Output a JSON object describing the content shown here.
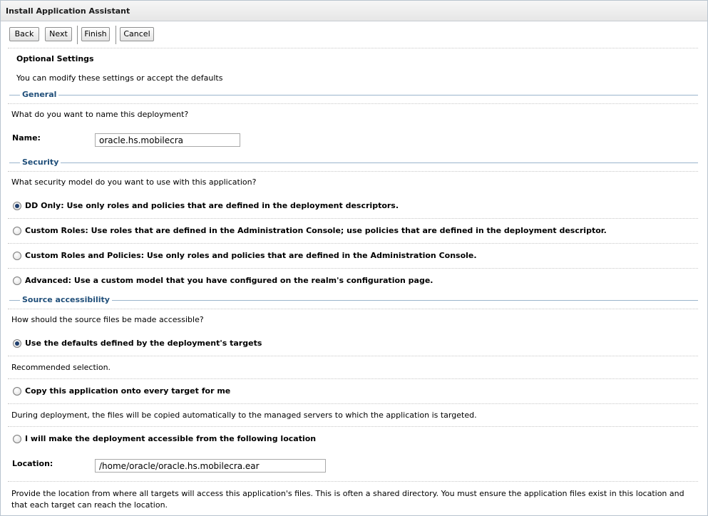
{
  "window": {
    "title": "Install Application Assistant"
  },
  "toolbar": {
    "back": "Back",
    "next": "Next",
    "finish": "Finish",
    "cancel": "Cancel"
  },
  "optional": {
    "heading": "Optional Settings",
    "subtitle": "You can modify these settings or accept the defaults"
  },
  "general": {
    "title": "General",
    "question": "What do you want to name this deployment?",
    "name_label": "Name:",
    "name_value": "oracle.hs.mobilecra"
  },
  "security": {
    "title": "Security",
    "question": "What security model do you want to use with this application?",
    "options": [
      {
        "label": "DD Only: Use only roles and policies that are defined in the deployment descriptors.",
        "selected": true
      },
      {
        "label": "Custom Roles: Use roles that are defined in the Administration Console; use policies that are defined in the deployment descriptor.",
        "selected": false
      },
      {
        "label": "Custom Roles and Policies: Use only roles and policies that are defined in the Administration Console.",
        "selected": false
      },
      {
        "label": "Advanced: Use a custom model that you have configured on the realm's configuration page.",
        "selected": false
      }
    ]
  },
  "source": {
    "title": "Source accessibility",
    "question": "How should the source files be made accessible?",
    "opt_defaults": "Use the defaults defined by the deployment's targets",
    "note_defaults": "Recommended selection.",
    "opt_copy": "Copy this application onto every target for me",
    "note_copy": "During deployment, the files will be copied automatically to the managed servers to which the application is targeted.",
    "opt_location": "I will make the deployment accessible from the following location",
    "location_label": "Location:",
    "location_value": "/home/oracle/oracle.hs.mobilecra.ear",
    "note_location": "Provide the location from where all targets will access this application's files. This is often a shared directory. You must ensure the application files exist in this location and that each target can reach the location."
  }
}
